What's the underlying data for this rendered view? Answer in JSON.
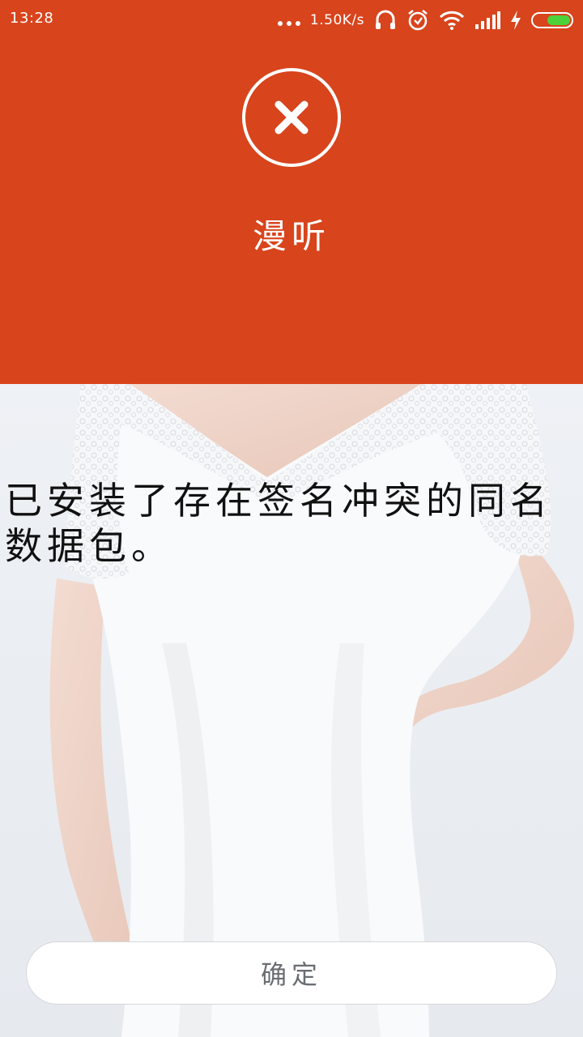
{
  "status_bar": {
    "time": "13:28",
    "net_speed": "1.50K/s"
  },
  "dialog": {
    "app_name": "漫听",
    "message": "已安装了存在签名冲突的同名数据包。",
    "confirm_label": "确定"
  },
  "colors": {
    "header_bg": "#d8441c",
    "battery_fill": "#4cd13a"
  },
  "icons": [
    "more-dots-icon",
    "headset-icon",
    "alarm-icon",
    "wifi-icon",
    "signal-icon",
    "charging-icon",
    "battery-icon",
    "error-close-icon"
  ]
}
